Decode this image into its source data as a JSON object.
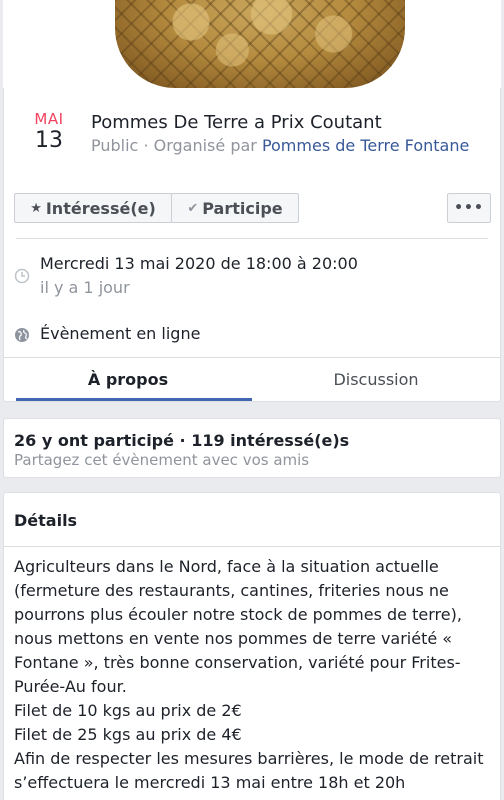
{
  "event": {
    "month": "MAI",
    "day": "13",
    "title": "Pommes De Terre a Prix Coutant",
    "visibility": "Public · Organisé par ",
    "organizer": "Pommes de Terre Fontane"
  },
  "actions": {
    "interested_label": "Intéressé(e)",
    "going_label": "Participe",
    "more_icon": "more-dots-icon"
  },
  "info": {
    "datetime": "Mercredi 13 mai 2020 de 18:00 à 20:00",
    "relative": "il y a 1 jour",
    "location": "Évènement en ligne"
  },
  "tabs": [
    {
      "label": "À propos",
      "active": true
    },
    {
      "label": "Discussion",
      "active": false
    }
  ],
  "stats": {
    "summary": "26 y ont participé · 119 intéressé(e)s",
    "share_prompt": "Partagez cet évènement avec vos amis"
  },
  "details": {
    "heading": "Détails",
    "lines": [
      "Agriculteurs dans le Nord, face à la situation actuelle (fermeture des restaurants, cantines, friteries nous ne pourrons plus écouler notre stock de pommes de terre), nous mettons en vente nos pommes de terre variété « Fontane », très bonne conservation, variété pour Frites-Purée-Au four.",
      "Filet de 10 kgs au prix de 2€",
      "Filet de 25 kgs au prix de 4€",
      "Afin de respecter les mesures barrières, le mode de retrait s’effectuera le mercredi 13 mai entre 18h et 20h"
    ]
  },
  "colors": {
    "accent": "#4267b2",
    "date_red": "#f3425f",
    "link": "#385898"
  }
}
